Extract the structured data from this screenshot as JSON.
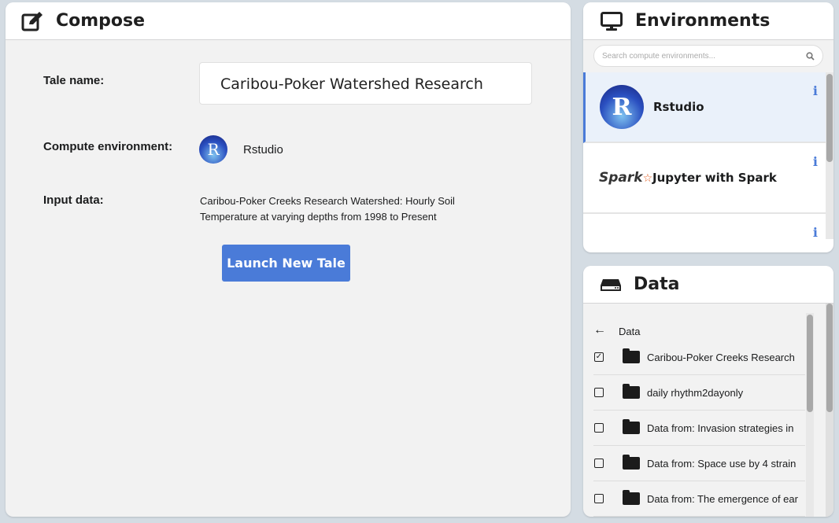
{
  "compose": {
    "title": "Compose",
    "tale_name_label": "Tale name:",
    "tale_name_value": "Caribou-Poker Watershed Research",
    "compute_env_label": "Compute environment:",
    "compute_env_value": "Rstudio",
    "input_data_label": "Input data:",
    "input_data_value": "Caribou-Poker Creeks Research Watershed: Hourly Soil Temperature at varying depths from 1998 to Present",
    "launch_label": "Launch New Tale"
  },
  "environments": {
    "title": "Environments",
    "search_placeholder": "Search compute environments...",
    "items": [
      {
        "name": "Rstudio",
        "logo": "R",
        "info": "i"
      },
      {
        "name": "Jupyter with Spark",
        "logo": "Spark",
        "info": "i"
      },
      {
        "name": "",
        "info": "i"
      }
    ]
  },
  "data": {
    "title": "Data",
    "back_label": "Data",
    "items": [
      {
        "name": "Caribou-Poker Creeks Research",
        "checked": true
      },
      {
        "name": "daily rhythm2dayonly",
        "checked": false
      },
      {
        "name": "Data from: Invasion strategies in",
        "checked": false
      },
      {
        "name": "Data from: Space use by 4 strain",
        "checked": false
      },
      {
        "name": "Data from: The emergence of ear",
        "checked": false
      }
    ]
  },
  "colors": {
    "accent": "#4a7bd8",
    "background": "#d4dce3"
  }
}
